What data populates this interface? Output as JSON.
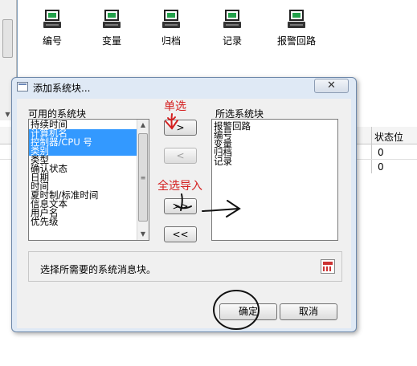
{
  "toolbar": {
    "icons": [
      {
        "label": "编号",
        "icon": "monitor-icon"
      },
      {
        "label": "变量",
        "icon": "monitor-icon"
      },
      {
        "label": "归档",
        "icon": "monitor-icon"
      },
      {
        "label": "记录",
        "icon": "monitor-icon"
      },
      {
        "label": "报警回路",
        "icon": "monitor-icon"
      }
    ]
  },
  "table": {
    "column_header": "状态位",
    "rows": [
      "0",
      "0"
    ]
  },
  "dialog": {
    "title": "添加系统块...",
    "close_label": "✕",
    "available_label": "可用的系统块",
    "selected_label": "所选系统块",
    "available_items": [
      {
        "text": "持续时间",
        "selected": false
      },
      {
        "text": "计算机名",
        "selected": true
      },
      {
        "text": "控制器/CPU 号",
        "selected": true
      },
      {
        "text": "类别",
        "selected": true
      },
      {
        "text": "类型",
        "selected": false
      },
      {
        "text": "确认状态",
        "selected": false
      },
      {
        "text": "日期",
        "selected": false
      },
      {
        "text": "时间",
        "selected": false
      },
      {
        "text": "夏时制/标准时间",
        "selected": false
      },
      {
        "text": "信息文本",
        "selected": false
      },
      {
        "text": "用户名",
        "selected": false
      },
      {
        "text": "优先级",
        "selected": false
      }
    ],
    "selected_items": [
      "报警回路",
      "编号",
      "变量",
      "归档",
      "记录"
    ],
    "buttons": {
      "add_one": ">",
      "remove_one": "<",
      "add_all": ">>",
      "remove_all": "<<"
    },
    "status_text": "选择所需要的系统消息块。",
    "ok_label": "确定",
    "cancel_label": "取消"
  },
  "annotations": {
    "single_select": "单选",
    "select_all_import": "全选导入"
  },
  "colors": {
    "selection": "#3399ff",
    "annotation_red": "#d42020",
    "dialog_border": "#6d88aa"
  }
}
